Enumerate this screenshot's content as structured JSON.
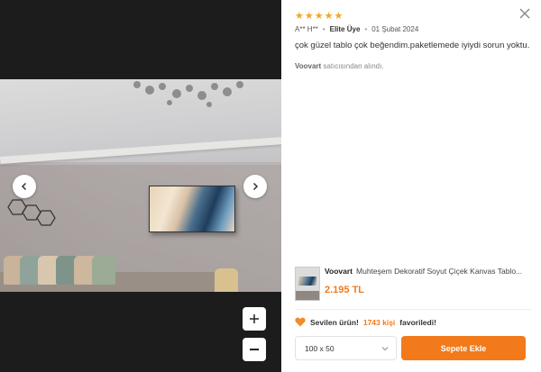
{
  "review": {
    "rating_stars": [
      "★",
      "★",
      "★",
      "★",
      "★"
    ],
    "rating_value": 5,
    "author": "A** H**",
    "badge": "Elite Üye",
    "separator": "•",
    "date": "01 Şubat 2024",
    "comment": "çok güzel tablo çok beğendim.paketlemede iyiydi sorun yoktu.",
    "seller_name": "Voovart",
    "seller_suffix": " satıcısından alındı."
  },
  "product": {
    "brand": "Voovart",
    "title": "Muhteşem Dekoratif Soyut Çiçek Kanvas Tablo...",
    "price": "2.195 TL"
  },
  "favorite": {
    "lead": "Sevilen ürün!",
    "count": "1743 kişi",
    "tail": "favoriledi!"
  },
  "actions": {
    "size_selected": "100 x 50",
    "add_to_cart": "Sepete Ekle"
  },
  "icons": {
    "close": "close-icon",
    "prev": "chevron-left-icon",
    "next": "chevron-right-icon",
    "zoom_in": "plus-icon",
    "zoom_out": "minus-icon",
    "heart": "heart-icon",
    "dropdown": "chevron-down-icon"
  },
  "colors": {
    "accent": "#f27a1a",
    "star": "#f6a623",
    "gallery_bg": "#1c1c1c"
  }
}
